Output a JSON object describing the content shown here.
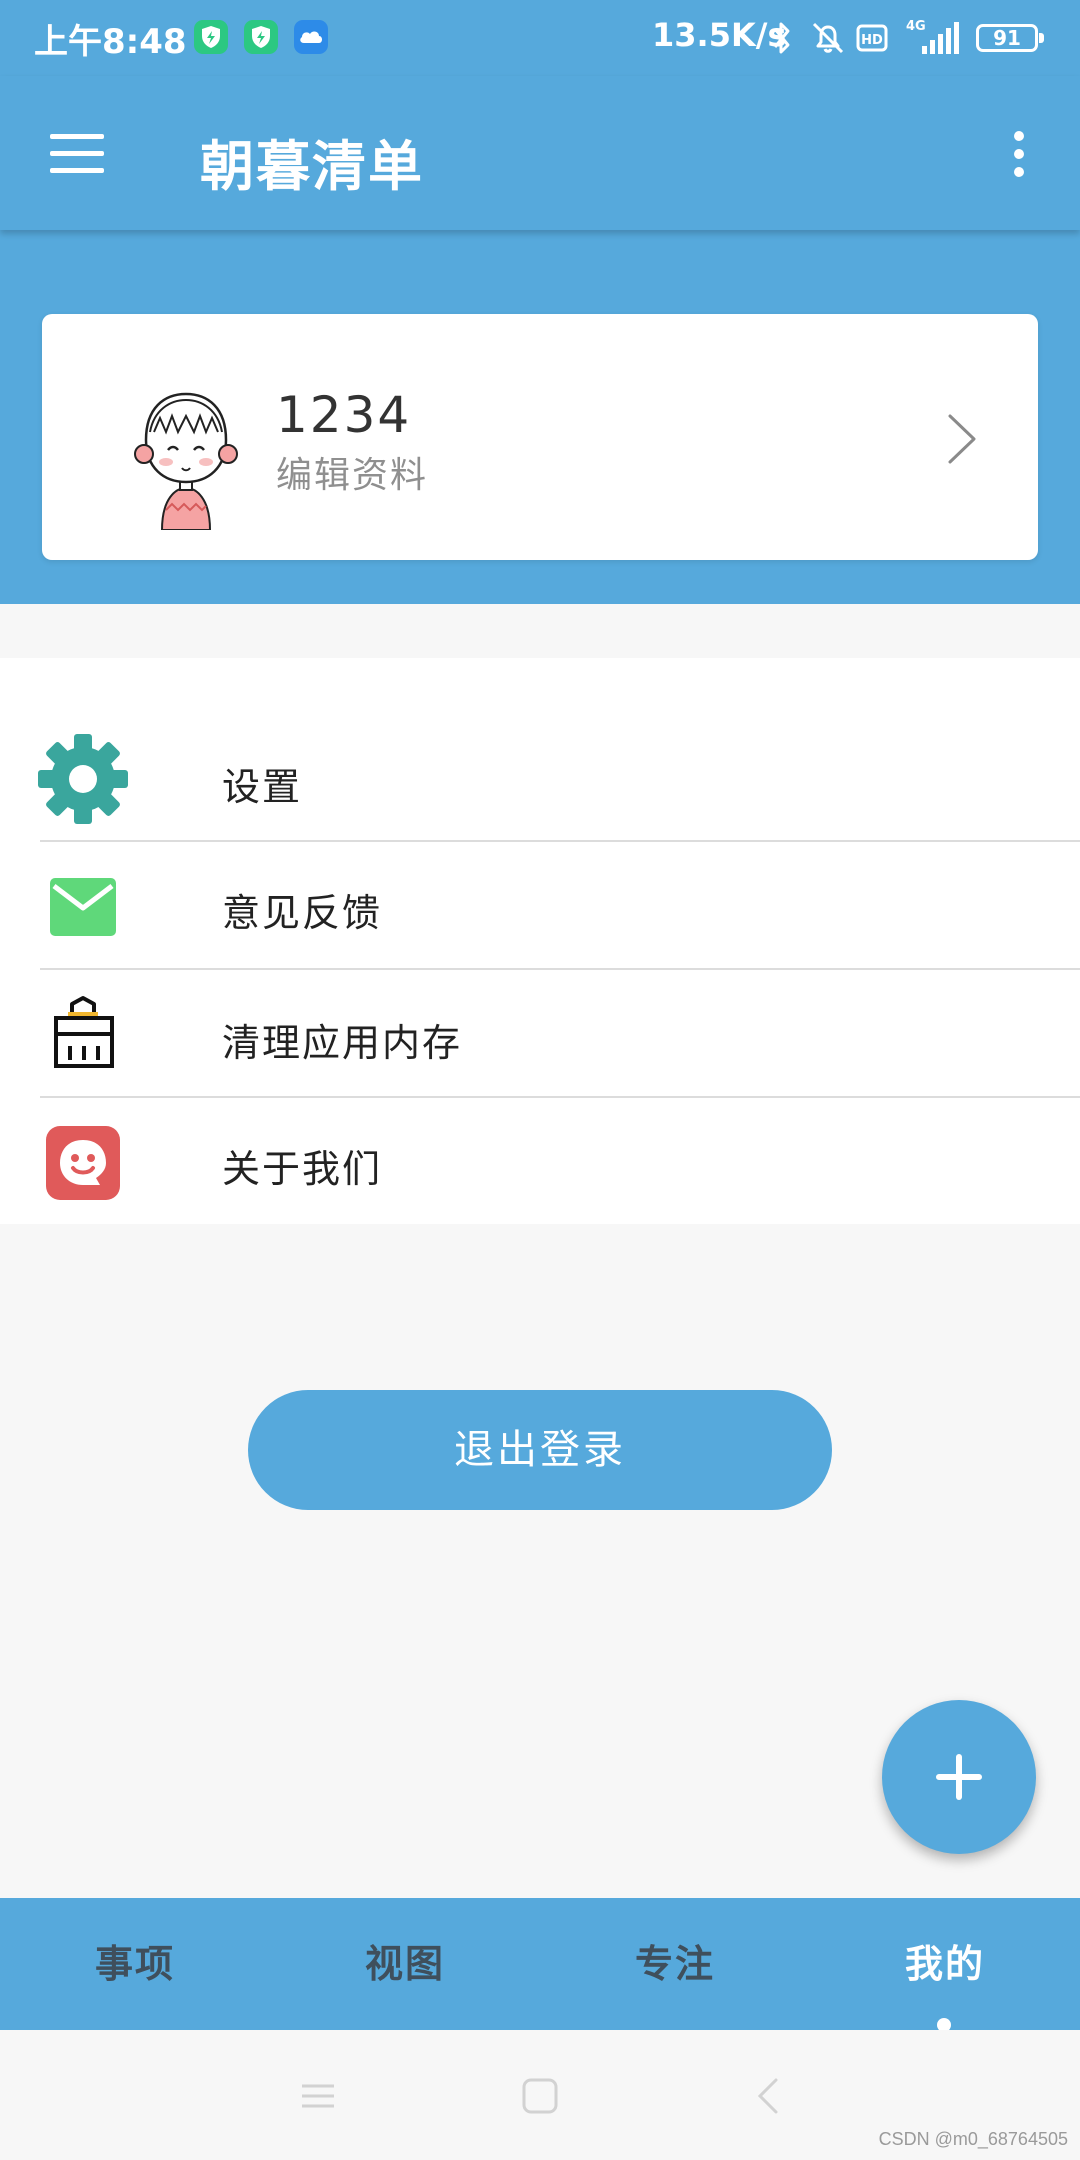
{
  "status_bar": {
    "time": "上午8:48",
    "network_speed": "13.5K/s",
    "network_type": "4G",
    "battery": "91",
    "icons": [
      "shield-app-icon",
      "shield-app-icon",
      "cloud-app-icon",
      "bluetooth-icon",
      "bell-off-icon",
      "hd-icon",
      "signal-icon",
      "battery-icon"
    ]
  },
  "app_bar": {
    "title": "朝暮清单",
    "menu_icon": "hamburger-menu-icon",
    "more_icon": "more-vertical-icon"
  },
  "profile": {
    "username": "1234",
    "edit_label": "编辑资料",
    "avatar_icon": "girl-avatar"
  },
  "menu": {
    "items": [
      {
        "label": "设置",
        "icon": "gear-icon"
      },
      {
        "label": "意见反馈",
        "icon": "mail-icon"
      },
      {
        "label": "清理应用内存",
        "icon": "trash-bag-icon"
      },
      {
        "label": "关于我们",
        "icon": "smile-face-icon"
      }
    ]
  },
  "logout_label": "退出登录",
  "fab": {
    "icon": "plus-icon"
  },
  "bottom_nav": {
    "tabs": [
      {
        "label": "事项"
      },
      {
        "label": "视图"
      },
      {
        "label": "专注"
      },
      {
        "label": "我的"
      }
    ],
    "active_index": 3
  },
  "watermark": "CSDN @m0_68764505",
  "colors": {
    "primary": "#56a9dc",
    "gear": "#3aa69d",
    "mail": "#5fd87a",
    "about": "#e05a5a",
    "text": "#222222",
    "secondary_text": "#8f8f8f"
  }
}
